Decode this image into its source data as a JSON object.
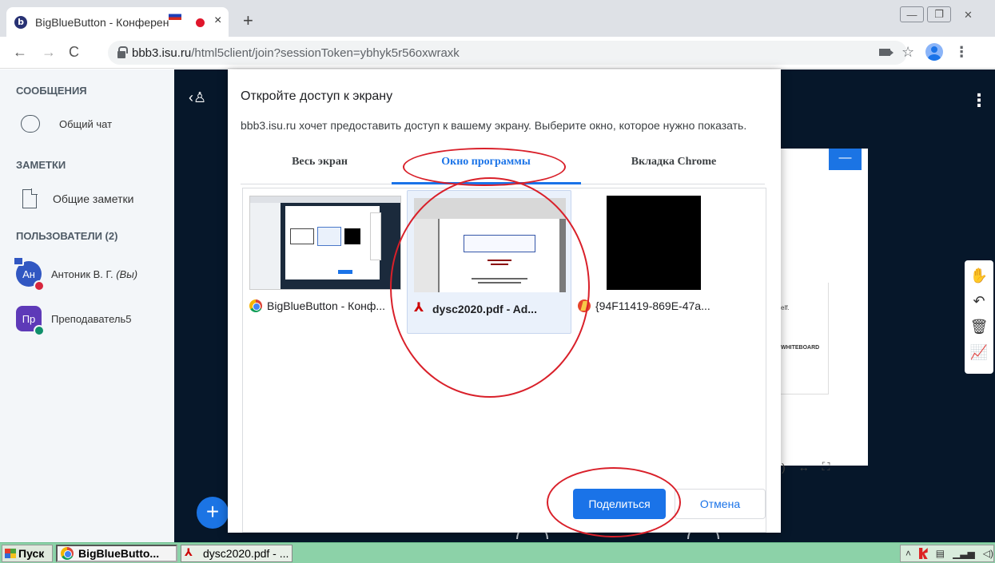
{
  "browser": {
    "tab_title": "BigBlueButton - Конферен",
    "tab_close": "×",
    "new_tab": "+",
    "url_host": "bbb3.isu.ru",
    "url_path": "/html5client/join?sessionToken=ybhyk5r56oxwraxk",
    "back": "←",
    "forward": "→",
    "reload": "C",
    "star": "☆",
    "menu": "⋮",
    "win_minimize": "—",
    "win_maximize": "❐",
    "win_close": "✕"
  },
  "sidebar": {
    "messages_heading": "СООБЩЕНИЯ",
    "public_chat": "Общий чат",
    "notes_heading": "ЗАМЕТКИ",
    "shared_notes": "Общие заметки",
    "users_heading": "ПОЛЬЗОВАТЕЛИ (2)",
    "users": [
      {
        "initials": "Ан",
        "name": "Антоник В. Г. ",
        "suffix": "(Вы)"
      },
      {
        "initials": "Пр",
        "name": "Преподаватель5"
      }
    ]
  },
  "main": {
    "userlist_toggle": "‹♙",
    "options": "⋮",
    "slide_minimize": "—",
    "slide_text_1": "elf.",
    "slide_text_2": "WHITEBOARD",
    "fit_width": "↔",
    "fullscreen": "⛶",
    "tools": [
      "✋",
      "↶",
      "🗑",
      "📈"
    ],
    "fab": "+"
  },
  "dialog": {
    "title": "Откройте доступ к экрану",
    "description": "bbb3.isu.ru хочет предоставить доступ к вашему экрану. Выберите окно, которое нужно показать.",
    "tabs": [
      "Весь экран",
      "Окно программы",
      "Вкладка Chrome"
    ],
    "active_tab": "Окно программы",
    "sources": [
      {
        "label": "BigBlueButton - Конф..."
      },
      {
        "label": "dysc2020.pdf - Ad..."
      },
      {
        "label": "{94F11419-869E-47a..."
      }
    ],
    "share_button": "Поделиться",
    "cancel_button": "Отмена"
  },
  "taskbar": {
    "start": "Пуск",
    "items": [
      "BigBlueButto...",
      "dysc2020.pdf - ..."
    ]
  },
  "colors": {
    "accent": "#1a73e8",
    "annotation": "#d9202a",
    "bbb_dark": "#06172a",
    "taskbar": "#8cd2a8"
  }
}
